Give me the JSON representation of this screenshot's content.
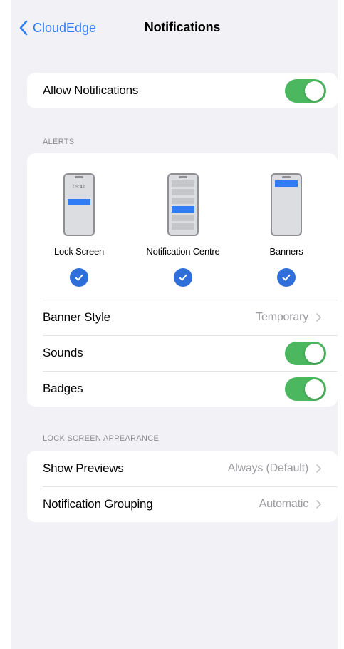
{
  "nav": {
    "back_label": "CloudEdge",
    "title": "Notifications"
  },
  "allow": {
    "label": "Allow Notifications",
    "enabled": true
  },
  "alerts": {
    "header": "ALERTS",
    "options": [
      {
        "label": "Lock Screen",
        "selected": true,
        "preview_time": "09:41"
      },
      {
        "label": "Notification Centre",
        "selected": true
      },
      {
        "label": "Banners",
        "selected": true
      }
    ],
    "banner_style": {
      "label": "Banner Style",
      "value": "Temporary"
    },
    "sounds": {
      "label": "Sounds",
      "enabled": true
    },
    "badges": {
      "label": "Badges",
      "enabled": true
    }
  },
  "lock_screen": {
    "header": "LOCK SCREEN APPEARANCE",
    "show_previews": {
      "label": "Show Previews",
      "value": "Always (Default)"
    },
    "grouping": {
      "label": "Notification Grouping",
      "value": "Automatic"
    }
  },
  "colors": {
    "accent": "#2f7cf6",
    "toggle_on": "#4bb85f",
    "background": "#f2f2f6"
  }
}
